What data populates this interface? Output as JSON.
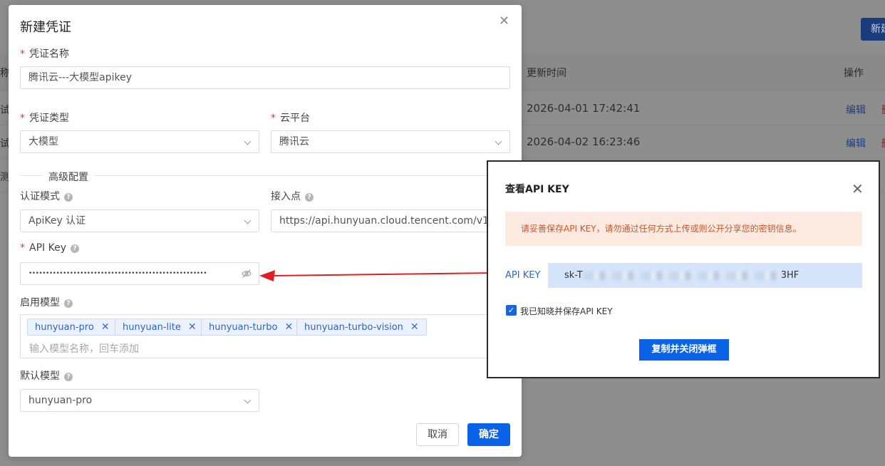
{
  "background": {
    "top_button": "新建",
    "table_header": {
      "left": "称",
      "updated_time": "更新时间",
      "actions": "操作"
    },
    "rows": [
      {
        "left": "试",
        "updated_time": "2026-04-01 17:42:41",
        "edit": "编辑",
        "del": "删"
      },
      {
        "left": "试",
        "updated_time": "2026-04-02 16:23:46",
        "edit": "编辑",
        "del": "删"
      },
      {
        "left": "测试",
        "updated_time": "",
        "edit": "",
        "del": ""
      }
    ]
  },
  "modal": {
    "title": "新建凭证",
    "close_icon": "close-icon",
    "name_label": "凭证名称",
    "name_value": "腾讯云---大模型apikey",
    "type_label": "凭证类型",
    "type_value": "大模型",
    "cloud_label": "云平台",
    "cloud_value": "腾讯云",
    "advanced_label": "高级配置",
    "auth_label": "认证模式",
    "auth_value": "ApiKey 认证",
    "endpoint_label": "接入点",
    "endpoint_value": "https://api.hunyuan.cloud.tencent.com/v1",
    "apikey_label": "API Key",
    "apikey_value": "••••••••••••••••••••••••••••••••••••••••••••••••••••",
    "models_label": "启用模型",
    "models": [
      "hunyuan-pro",
      "hunyuan-lite",
      "hunyuan-turbo",
      "hunyuan-turbo-vision"
    ],
    "models_placeholder": "输入模型名称，回车添加",
    "default_model_label": "默认模型",
    "default_model_value": "hunyuan-pro",
    "cancel": "取消",
    "ok": "确定"
  },
  "keybox": {
    "title": "查看API KEY",
    "warning": "请妥善保存API KEY，请勿通过任何方式上传或则公开分享您的密钥信息。",
    "key_label": "API KEY",
    "key_prefix": "sk-T",
    "key_suffix": "3HF",
    "checkbox_label": "我已知晓并保存API KEY",
    "checkbox_checked": true,
    "copy_button": "复制并关闭弹框"
  },
  "colors": {
    "primary": "#0a63e6",
    "required": "#e33333",
    "warning_bg": "#fce9df",
    "warning_text": "#c7562a",
    "arrow": "#e02020"
  }
}
